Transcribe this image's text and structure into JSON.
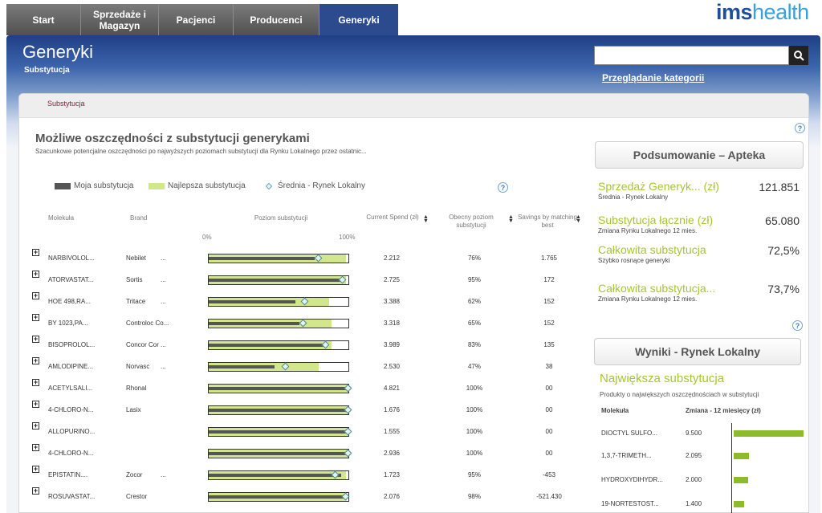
{
  "nav": {
    "tabs": [
      {
        "label": "Start"
      },
      {
        "label": "Sprzedaże i Magazyn"
      },
      {
        "label": "Pacjenci"
      },
      {
        "label": "Producenci"
      },
      {
        "label": "Generyki"
      }
    ],
    "active_tab": "Generyki"
  },
  "brand": {
    "logo_part1": "ims",
    "logo_part2": "health"
  },
  "header": {
    "title": "Generyki",
    "subtitle": "Substytucja",
    "search_placeholder": "",
    "browse_link": "Przeglądanie kategorii"
  },
  "breadcrumb": "Substytucja",
  "main": {
    "title": "Możliwe oszczędności z substytucji generykami",
    "description": "Szacunkowe potencjalne oszczędności po najwyższych poziomach substytucji dla Rynku Lokalnego przez ostatnic...",
    "legend": {
      "mine": "Moja substytucja",
      "best": "Najlepsza substytucja",
      "avg": "Średnia - Rynek Lokalny"
    },
    "columns": {
      "molecule": "Molekuła",
      "brand": "Brand",
      "level": "Poziom substytucji",
      "spend": "Current Spend (zł)",
      "current_level": "Obecny poziom substytucji",
      "savings": "Savings by matching best"
    },
    "scale_min": "0%",
    "scale_max": "100%",
    "rows": [
      {
        "molecule": "NARBIVOLOL...",
        "brand": "Nebilet",
        "more": "...",
        "mine": 0.76,
        "best": 0.98,
        "avg": 0.79,
        "spend": "2.212",
        "current": "76%",
        "savings": "1.765"
      },
      {
        "molecule": "ATORVASTAT...",
        "brand": "Sortis",
        "more": "...",
        "mine": 0.95,
        "best": 0.98,
        "avg": 0.96,
        "spend": "2.725",
        "current": "95%",
        "savings": "172"
      },
      {
        "molecule": "HOE 498,RA...",
        "brand": "Tritace",
        "more": "...",
        "mine": 0.62,
        "best": 0.86,
        "avg": 0.69,
        "spend": "3.388",
        "current": "62%",
        "savings": "152"
      },
      {
        "molecule": "BY 1023,PA...",
        "brand": "Controloc Co...",
        "more": "",
        "mine": 0.65,
        "best": 0.88,
        "avg": 0.68,
        "spend": "3.318",
        "current": "65%",
        "savings": "152"
      },
      {
        "molecule": "BISOPROLOL...",
        "brand": "Concor Cor",
        "more": "...",
        "mine": 0.83,
        "best": 0.88,
        "avg": 0.84,
        "spend": "3.989",
        "current": "83%",
        "savings": "135"
      },
      {
        "molecule": "AMLODIPINE...",
        "brand": "Norvasc",
        "more": "...",
        "mine": 0.47,
        "best": 0.79,
        "avg": 0.55,
        "spend": "2.530",
        "current": "47%",
        "savings": "38"
      },
      {
        "molecule": "ACETYLSALI...",
        "brand": "Rhonal",
        "more": "",
        "mine": 1.0,
        "best": 1.0,
        "avg": 1.0,
        "spend": "4.821",
        "current": "100%",
        "savings": "00"
      },
      {
        "molecule": "4-CHLORO-N...",
        "brand": "Lasix",
        "more": "",
        "mine": 1.0,
        "best": 1.0,
        "avg": 1.0,
        "spend": "1.676",
        "current": "100%",
        "savings": "00"
      },
      {
        "molecule": "ALLOPURINO...",
        "brand": "",
        "more": "",
        "mine": 1.0,
        "best": 1.0,
        "avg": 1.0,
        "spend": "1.555",
        "current": "100%",
        "savings": "00"
      },
      {
        "molecule": "4-CHLORO-N...",
        "brand": "",
        "more": "",
        "mine": 1.0,
        "best": 1.0,
        "avg": 1.0,
        "spend": "2.936",
        "current": "100%",
        "savings": "00"
      },
      {
        "molecule": "EPISTATIN....",
        "brand": "Zocor",
        "more": "...",
        "mine": 0.95,
        "best": 0.98,
        "avg": 0.91,
        "spend": "1.723",
        "current": "95%",
        "savings": "-453"
      },
      {
        "molecule": "ROSUVASTAT...",
        "brand": "Crestor",
        "more": "",
        "mine": 0.98,
        "best": 0.99,
        "avg": 0.98,
        "spend": "2.076",
        "current": "98%",
        "savings": "-521.430"
      }
    ]
  },
  "summary": {
    "title": "Podsumowanie – Apteka",
    "items": [
      {
        "label": "Sprzedaż Generyk... (zł)",
        "sub": "Średnia - Rynek Lokalny",
        "value": "121.851"
      },
      {
        "label": "Substytucja łącznie (zł)",
        "sub": "Zmiana Rynku Lokalnego 12 mies.",
        "value": "65.080"
      },
      {
        "label": "Całkowita substytucja",
        "sub": "Szybko rosnące generyki",
        "value": "72,5%"
      },
      {
        "label": "Całkowita substytucja...",
        "sub": "Zmiana Rynku Lokalnego 12 mies.",
        "value": "73,7%"
      }
    ]
  },
  "local": {
    "title": "Wyniki - Rynek Lokalny",
    "heading": "Największa substytucja",
    "description": "Produkty o największych oszczędnościach w substytucji",
    "col_molecule": "Molekuła",
    "col_change": "Zmiana - 12 miesięcy (zł)",
    "rows": [
      {
        "molecule": "DIOCTYL SULFO...",
        "value": "9.500",
        "amount": 9500
      },
      {
        "molecule": "1,3,7-TRIMETH...",
        "value": "2.095",
        "amount": 2095
      },
      {
        "molecule": "HYDROXYDIHYDR...",
        "value": "2.000",
        "amount": 2000
      },
      {
        "molecule": "19-NORTESTOST...",
        "value": "1.400",
        "amount": 1400
      }
    ]
  },
  "colors": {
    "accent_green": "#a7c52f",
    "nav_active": "#2c4a8e",
    "bar_best": "#d2e68c",
    "bar_mine": "#555555",
    "breadcrumb": "#8b1b3d"
  }
}
